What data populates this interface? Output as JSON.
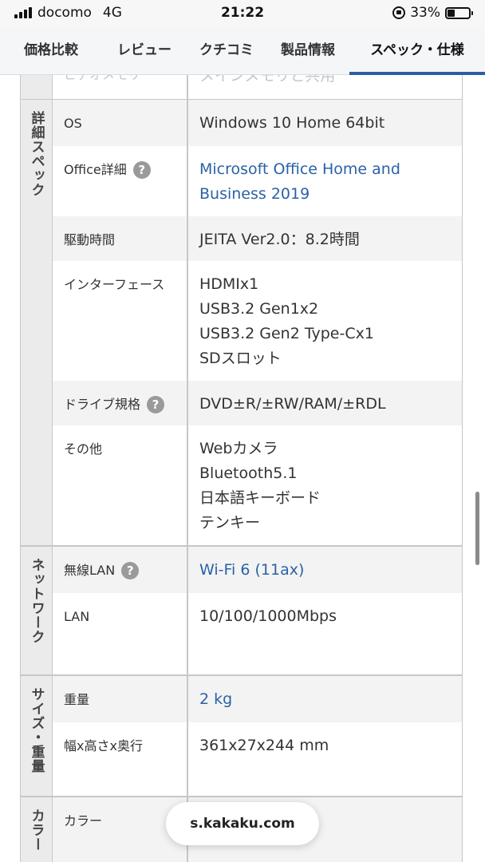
{
  "status_bar": {
    "carrier": "docomo",
    "network": "4G",
    "time": "21:22",
    "battery": "33%",
    "battery_level": 0.33
  },
  "tabs": [
    {
      "label": "価格比較",
      "active": false
    },
    {
      "label": "レビュー",
      "active": false
    },
    {
      "label": "クチコミ",
      "active": false
    },
    {
      "label": "製品情報",
      "active": false
    },
    {
      "label": "スペック・仕様",
      "active": true
    }
  ],
  "partial_row": {
    "name": "ビデオメモリ",
    "value": "メインメモリと共用"
  },
  "groups": [
    {
      "label": "詳細スペック",
      "rows": [
        {
          "name": "OS",
          "help": false,
          "value": [
            "Windows 10 Home 64bit"
          ],
          "link": false
        },
        {
          "name": "Office詳細",
          "help": true,
          "value": [
            "Microsoft Office Home and",
            "Business 2019"
          ],
          "link": true
        },
        {
          "name": "駆動時間",
          "help": false,
          "value": [
            "JEITA Ver2.0：8.2時間"
          ],
          "link": false
        },
        {
          "name": "インターフェース",
          "help": false,
          "value": [
            "HDMIx1",
            "USB3.2 Gen1x2",
            "USB3.2 Gen2 Type-Cx1",
            "SDスロット"
          ],
          "link": false
        },
        {
          "name": "ドライブ規格",
          "help": true,
          "value": [
            "DVD±R/±RW/RAM/±RDL"
          ],
          "link": false
        },
        {
          "name": "その他",
          "help": false,
          "value": [
            "Webカメラ",
            "Bluetooth5.1",
            "日本語キーボード",
            "テンキー"
          ],
          "link": false
        }
      ]
    },
    {
      "label": "ネットワーク",
      "rows": [
        {
          "name": "無線LAN",
          "help": true,
          "value": [
            "Wi-Fi 6 (11ax)"
          ],
          "link": true
        },
        {
          "name": "LAN",
          "help": false,
          "value": [
            "10/100/1000Mbps"
          ],
          "link": false
        }
      ]
    },
    {
      "label": "サイズ・重量",
      "rows": [
        {
          "name": "重量",
          "help": false,
          "value": [
            "2 kg"
          ],
          "link": true
        },
        {
          "name": "幅x高さx奥行",
          "help": false,
          "value": [
            "361x27x244 mm"
          ],
          "link": false
        }
      ]
    },
    {
      "label": "カラー",
      "rows": [
        {
          "name": "カラー",
          "help": false,
          "value": [
            "ー"
          ],
          "link": false
        }
      ]
    }
  ],
  "help_icon_glyph": "?",
  "url": "s.kakaku.com",
  "colors": {
    "accent": "#2b5da3",
    "link": "#2a62a6"
  }
}
